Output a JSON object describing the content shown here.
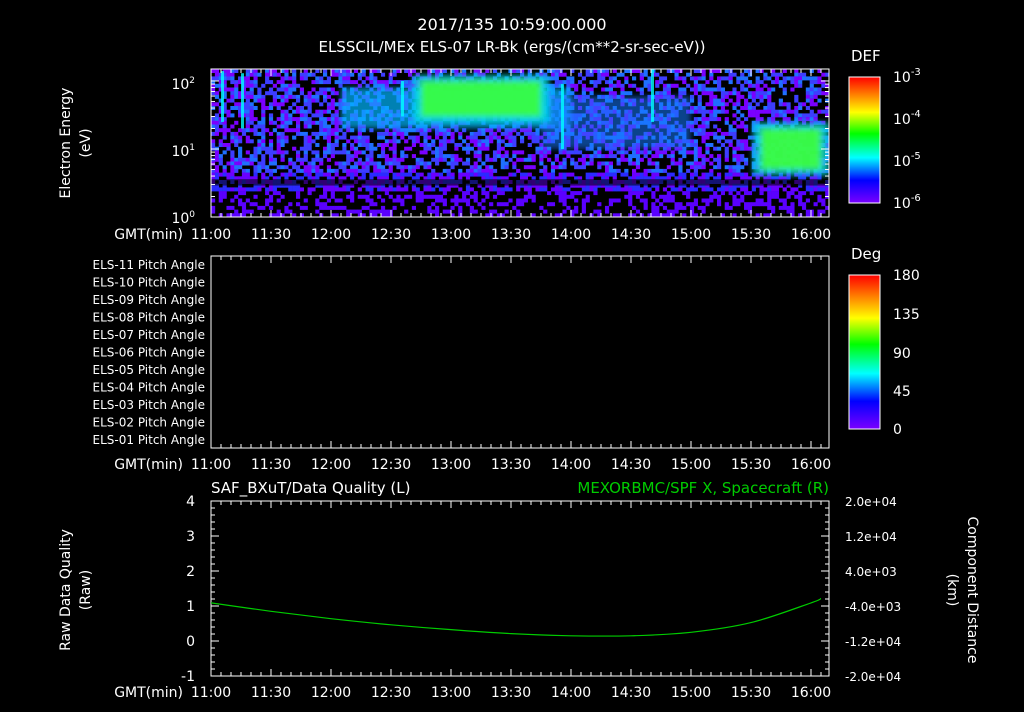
{
  "header": {
    "timestamp": "2017/135 10:59:00.000",
    "title": "ELSSCIL/MEx ELS-07 LR-Bk  (ergs/(cm**2-sr-sec-eV))"
  },
  "time_axis": {
    "label": "GMT(min)",
    "ticks": [
      "11:00",
      "11:30",
      "12:00",
      "12:30",
      "13:00",
      "13:30",
      "14:00",
      "14:30",
      "15:00",
      "15:30",
      "16:00"
    ]
  },
  "panel1": {
    "ylabel_line1": "Electron Energy",
    "ylabel_line2": "(eV)",
    "yticks": [
      {
        "label": "10",
        "exp": "2"
      },
      {
        "label": "10",
        "exp": "1"
      },
      {
        "label": "10",
        "exp": "0"
      }
    ],
    "colorbar": {
      "label": "DEF",
      "ticks": [
        {
          "label": "10",
          "exp": "-3"
        },
        {
          "label": "10",
          "exp": "-4"
        },
        {
          "label": "10",
          "exp": "-5"
        },
        {
          "label": "10",
          "exp": "-6"
        }
      ]
    }
  },
  "panel2": {
    "rows": [
      "ELS-11 Pitch Angle",
      "ELS-10 Pitch Angle",
      "ELS-09 Pitch Angle",
      "ELS-08 Pitch Angle",
      "ELS-07 Pitch Angle",
      "ELS-06 Pitch Angle",
      "ELS-05 Pitch Angle",
      "ELS-04 Pitch Angle",
      "ELS-03 Pitch Angle",
      "ELS-02 Pitch Angle",
      "ELS-01 Pitch Angle"
    ],
    "colorbar": {
      "label": "Deg",
      "ticks": [
        "180",
        "135",
        "90",
        "45",
        "0"
      ]
    }
  },
  "panel3": {
    "left_title": "SAF_BXuT/Data Quality (L)",
    "right_title": "MEXORBMC/SPF X, Spacecraft (R)",
    "ylabel_left_line1": "Raw Data Quality",
    "ylabel_left_line2": "(Raw)",
    "ylabel_right_line1": "Component Distance",
    "ylabel_right_line2": "(km)",
    "left_ticks": [
      "4",
      "3",
      "2",
      "1",
      "0",
      "-1"
    ],
    "right_ticks": [
      "2.0e+04",
      "1.2e+04",
      "4.0e+03",
      "-4.0e+03",
      "-1.2e+04",
      "-2.0e+04"
    ],
    "line_color": "#00cc00"
  },
  "chart_data": [
    {
      "type": "heatmap",
      "title": "ELSSCIL/MEx ELS-07 LR-Bk  (ergs/(cm**2-sr-sec-eV))",
      "xlabel": "GMT(min)",
      "ylabel": "Electron Energy (eV)",
      "x_ticks": [
        "11:00",
        "11:30",
        "12:00",
        "12:30",
        "13:00",
        "13:30",
        "14:00",
        "14:30",
        "15:00",
        "15:30",
        "16:00"
      ],
      "y_scale": "log",
      "ylim": [
        1,
        150
      ],
      "colorbar": {
        "label": "DEF",
        "scale": "log",
        "range": [
          1e-06,
          0.001
        ]
      },
      "features": [
        {
          "time_range": [
            "12:45",
            "13:45"
          ],
          "energy_range_eV": [
            30,
            100
          ],
          "level": "green (~1e-4)"
        },
        {
          "time_range": [
            "15:35",
            "16:05"
          ],
          "energy_range_eV": [
            5,
            20
          ],
          "level": "green (~1e-4)"
        }
      ]
    },
    {
      "type": "heatmap",
      "xlabel": "GMT(min)",
      "rows": [
        "ELS-11",
        "ELS-10",
        "ELS-09",
        "ELS-08",
        "ELS-07",
        "ELS-06",
        "ELS-05",
        "ELS-04",
        "ELS-03",
        "ELS-02",
        "ELS-01"
      ],
      "colorbar": {
        "label": "Deg",
        "range": [
          0,
          180
        ]
      },
      "values": "empty"
    },
    {
      "type": "line",
      "xlabel": "GMT(min)",
      "ylabel": "Component Distance (km)",
      "ylim": [
        -20000,
        20000
      ],
      "ylim_left": [
        -1,
        4
      ],
      "series": [
        {
          "name": "MEXORBMC/SPF X, Spacecraft (R)",
          "x": [
            "11:00",
            "11:30",
            "12:00",
            "12:30",
            "13:00",
            "13:30",
            "14:00",
            "14:30",
            "15:00",
            "15:30",
            "16:00",
            "16:05"
          ],
          "values": [
            -3300,
            -5200,
            -6900,
            -8300,
            -9400,
            -10300,
            -10800,
            -10800,
            -10000,
            -7800,
            -3300,
            -2300
          ]
        }
      ]
    }
  ]
}
